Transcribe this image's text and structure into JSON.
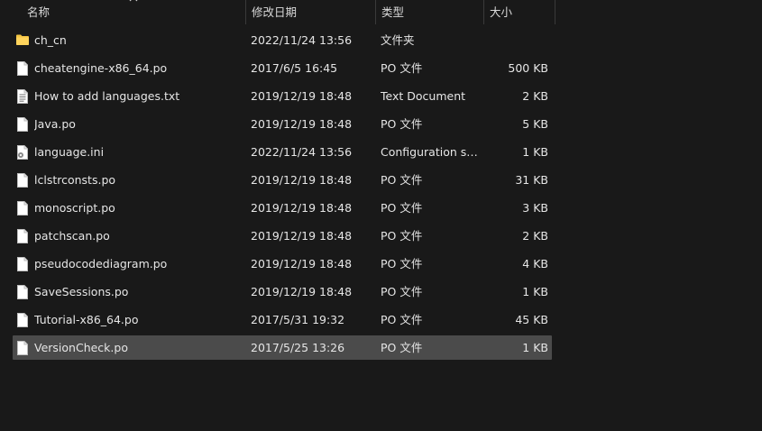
{
  "columns": {
    "name": "名称",
    "date": "修改日期",
    "type": "类型",
    "size": "大小"
  },
  "files": [
    {
      "name": "ch_cn",
      "date": "2022/11/24 13:56",
      "type": "文件夹",
      "size": "",
      "icon": "folder-icon"
    },
    {
      "name": "cheatengine-x86_64.po",
      "date": "2017/6/5 16:45",
      "type": "PO 文件",
      "size": "500 KB",
      "icon": "file-icon"
    },
    {
      "name": "How to add languages.txt",
      "date": "2019/12/19 18:48",
      "type": "Text Document",
      "size": "2 KB",
      "icon": "text-file-icon"
    },
    {
      "name": "Java.po",
      "date": "2019/12/19 18:48",
      "type": "PO 文件",
      "size": "5 KB",
      "icon": "file-icon"
    },
    {
      "name": "language.ini",
      "date": "2022/11/24 13:56",
      "type": "Configuration se...",
      "size": "1 KB",
      "icon": "config-file-icon"
    },
    {
      "name": "lclstrconsts.po",
      "date": "2019/12/19 18:48",
      "type": "PO 文件",
      "size": "31 KB",
      "icon": "file-icon"
    },
    {
      "name": "monoscript.po",
      "date": "2019/12/19 18:48",
      "type": "PO 文件",
      "size": "3 KB",
      "icon": "file-icon"
    },
    {
      "name": "patchscan.po",
      "date": "2019/12/19 18:48",
      "type": "PO 文件",
      "size": "2 KB",
      "icon": "file-icon"
    },
    {
      "name": "pseudocodediagram.po",
      "date": "2019/12/19 18:48",
      "type": "PO 文件",
      "size": "4 KB",
      "icon": "file-icon"
    },
    {
      "name": "SaveSessions.po",
      "date": "2019/12/19 18:48",
      "type": "PO 文件",
      "size": "1 KB",
      "icon": "file-icon"
    },
    {
      "name": "Tutorial-x86_64.po",
      "date": "2017/5/31 19:32",
      "type": "PO 文件",
      "size": "45 KB",
      "icon": "file-icon"
    },
    {
      "name": "VersionCheck.po",
      "date": "2017/5/25 13:26",
      "type": "PO 文件",
      "size": "1 KB",
      "icon": "file-icon",
      "selected": true
    }
  ],
  "colors": {
    "background": "#191919",
    "selection": "#4b4b4b",
    "folder": "#f4c543",
    "text": "#e6e6e6"
  }
}
